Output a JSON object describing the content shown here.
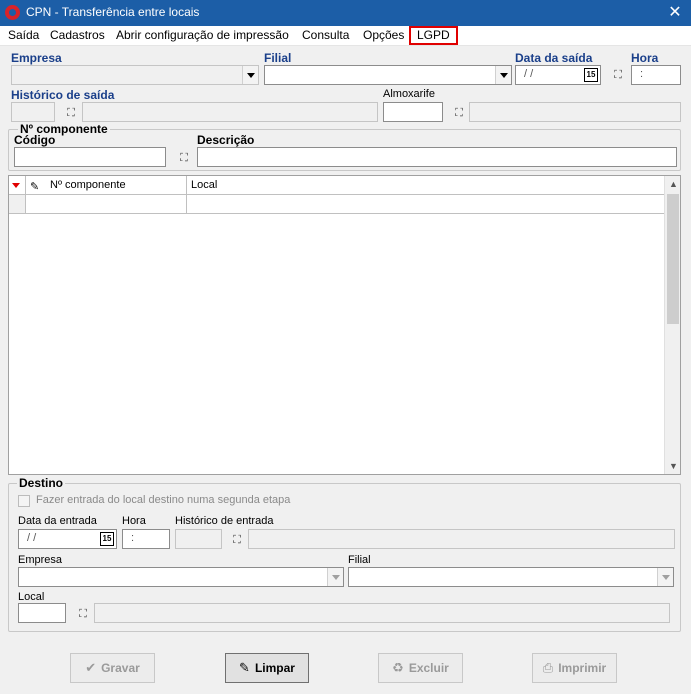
{
  "window": {
    "title": "CPN - Transferência entre locais",
    "close": "✕"
  },
  "menu": {
    "items": [
      "Saída",
      "Cadastros",
      "Abrir configuração de impressão",
      "Consulta",
      "Opções",
      "LGPD"
    ],
    "highlighted": "LGPD",
    "highlight_color": "#e00000"
  },
  "header": {
    "empresa_label": "Empresa",
    "empresa_value": "",
    "filial_label": "Filial",
    "filial_value": "",
    "data_saida_label": "Data da saída",
    "data_saida_value": " /  /",
    "hora_label": "Hora",
    "hora_value": ":",
    "historico_label": "Histórico de saída",
    "almoxarife_label": "Almoxarife",
    "calendar_badge": "15"
  },
  "componente": {
    "group_title": "Nº componente",
    "codigo_label": "Código",
    "codigo_value": "",
    "descricao_label": "Descrição",
    "descricao_value": ""
  },
  "grid": {
    "columns": [
      "Nº componente",
      "Local"
    ],
    "rows": [
      [
        "",
        ""
      ]
    ]
  },
  "destino": {
    "group_title": "Destino",
    "checkbox_label": "Fazer entrada do local destino numa segunda etapa",
    "checkbox_checked": false,
    "data_entrada_label": "Data da entrada",
    "data_entrada_value": " /  /",
    "hora_label": "Hora",
    "hora_value": ":",
    "historico_label": "Histórico de entrada",
    "empresa_label": "Empresa",
    "filial_label": "Filial",
    "local_label": "Local"
  },
  "buttons": {
    "gravar": "Gravar",
    "limpar": "Limpar",
    "excluir": "Excluir",
    "imprimir": "Imprimir"
  },
  "icons": {
    "search": "binoculars-icon",
    "calendar": "calendar-icon",
    "gravar": "checkmark-icon",
    "limpar": "eraser-icon",
    "excluir": "trash-icon",
    "imprimir": "printer-icon"
  },
  "colors": {
    "titlebar": "#1c5ea7",
    "label_blue": "#1a3f8a",
    "highlight": "#e00000"
  }
}
